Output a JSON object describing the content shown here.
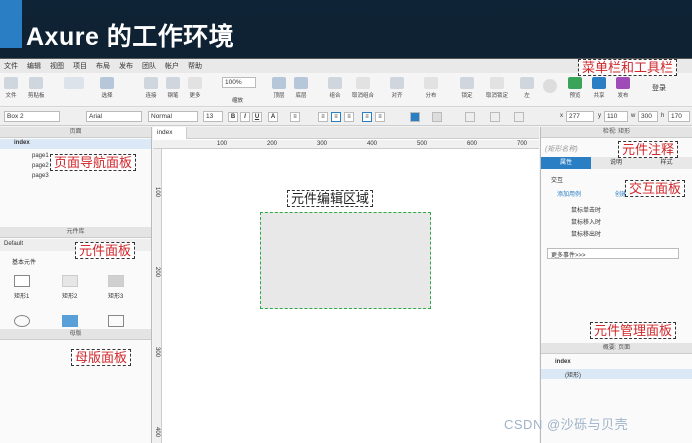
{
  "slide": {
    "title": "Axure 的工作环境",
    "watermark": "CSDN @沙砾与贝壳"
  },
  "menu": [
    "文件",
    "编辑",
    "视图",
    "项目",
    "布局",
    "发布",
    "团队",
    "帐户",
    "帮助"
  ],
  "toolbar": {
    "paste": "粘贴",
    "file": "文件",
    "clipboard": "剪贴板",
    "select": "选择",
    "connect": "连接",
    "pen": "钢笔",
    "more": "更多",
    "zoom": "100%",
    "zoom_label": "缩放",
    "top": "顶层",
    "bottom": "底层",
    "group": "组合",
    "ungroup": "取消组合",
    "align": "对齐",
    "distribute": "分布",
    "lock": "锁定",
    "unlock": "取消锁定",
    "left": "左",
    "preview": "预览",
    "share": "共享",
    "publish": "发布",
    "login": "登录"
  },
  "format": {
    "shape_name": "Box 2",
    "font": "Arial",
    "style": "Normal",
    "size": "13",
    "x": "277",
    "y": "110",
    "w": "300",
    "h": "170"
  },
  "pages_panel": {
    "title": "页面",
    "root": "index",
    "pages": [
      "page1",
      "page2",
      "page3"
    ]
  },
  "widgets_panel": {
    "title": "元件库",
    "library": "Default",
    "group": "基本元件",
    "items": [
      "矩形1",
      "矩形2",
      "矩形3"
    ]
  },
  "masters_panel": {
    "title": "母版"
  },
  "canvas": {
    "tab": "index",
    "ruler_top": [
      "100",
      "200",
      "300",
      "400",
      "500",
      "600",
      "700"
    ],
    "ruler_left": [
      "100",
      "200",
      "300",
      "400"
    ]
  },
  "inspector": {
    "title": "检视: 矩形",
    "shape_name_placeholder": "(矩形名称)",
    "tabs": [
      "属性",
      "说明",
      "样式"
    ],
    "interaction": "交互",
    "add_case": "添加用例",
    "create_link": "创建连接",
    "events": [
      "鼠标单击时",
      "鼠标移入时",
      "鼠标移出时"
    ],
    "more_events": "更多事件>>>"
  },
  "outline_panel": {
    "title": "概要: 页面",
    "root": "index",
    "child": "(矩形)"
  },
  "annotations": {
    "menubar": "菜单栏和工具栏",
    "pages": "页面导航面板",
    "widget_note": "元件注释",
    "interaction": "交互面板",
    "edit_area": "元件编辑区域",
    "widgets": "元件面板",
    "outline": "元件管理面板",
    "masters": "母版面板"
  },
  "colors": {
    "accent": "#2a7fc4",
    "annotation_text": "#d0262a",
    "selection": "#1e90ff"
  }
}
